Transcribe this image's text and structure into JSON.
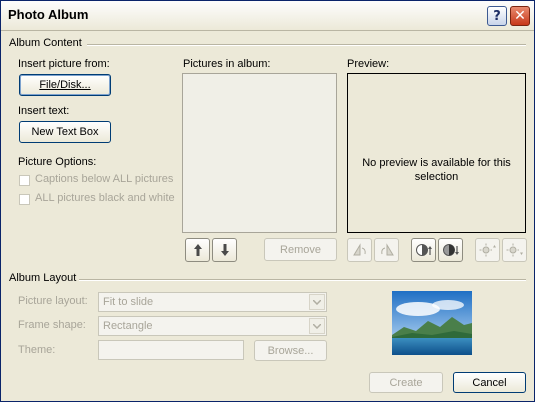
{
  "window": {
    "title": "Photo Album",
    "help_symbol": "?",
    "close_symbol": "✕"
  },
  "album_content": {
    "group_title": "Album Content",
    "insert_picture_label": "Insert picture from:",
    "file_disk_button": "File/Disk...",
    "insert_text_label": "Insert text:",
    "new_text_box_button": "New Text Box",
    "picture_options_label": "Picture Options:",
    "options": [
      {
        "label": "Captions below ALL pictures",
        "checked": false,
        "enabled": false
      },
      {
        "label": "ALL pictures black and white",
        "checked": false,
        "enabled": false
      }
    ],
    "pictures_in_album_label": "Pictures in album:",
    "preview_label": "Preview:",
    "preview_message": "No preview is available for this selection",
    "remove_button": "Remove",
    "tools": [
      {
        "name": "move-up-icon",
        "enabled": true
      },
      {
        "name": "move-down-icon",
        "enabled": true
      },
      {
        "name": "rotate-left-icon",
        "enabled": false
      },
      {
        "name": "rotate-right-icon",
        "enabled": false
      },
      {
        "name": "contrast-up-icon",
        "enabled": true
      },
      {
        "name": "contrast-down-icon",
        "enabled": true
      },
      {
        "name": "brightness-up-icon",
        "enabled": false
      },
      {
        "name": "brightness-down-icon",
        "enabled": false
      }
    ]
  },
  "album_layout": {
    "group_title": "Album Layout",
    "picture_layout_label": "Picture layout:",
    "picture_layout_value": "Fit to slide",
    "frame_shape_label": "Frame shape:",
    "frame_shape_value": "Rectangle",
    "theme_label": "Theme:",
    "theme_value": "",
    "browse_button": "Browse...",
    "thumbnail_icon": "landscape-thumbnail-image"
  },
  "footer": {
    "create_button": "Create",
    "cancel_button": "Cancel"
  },
  "colors": {
    "dialog_bg": "#ece9d8",
    "disabled_text": "#a8a599",
    "button_border": "#003c74",
    "close_red": "#c8381a"
  }
}
